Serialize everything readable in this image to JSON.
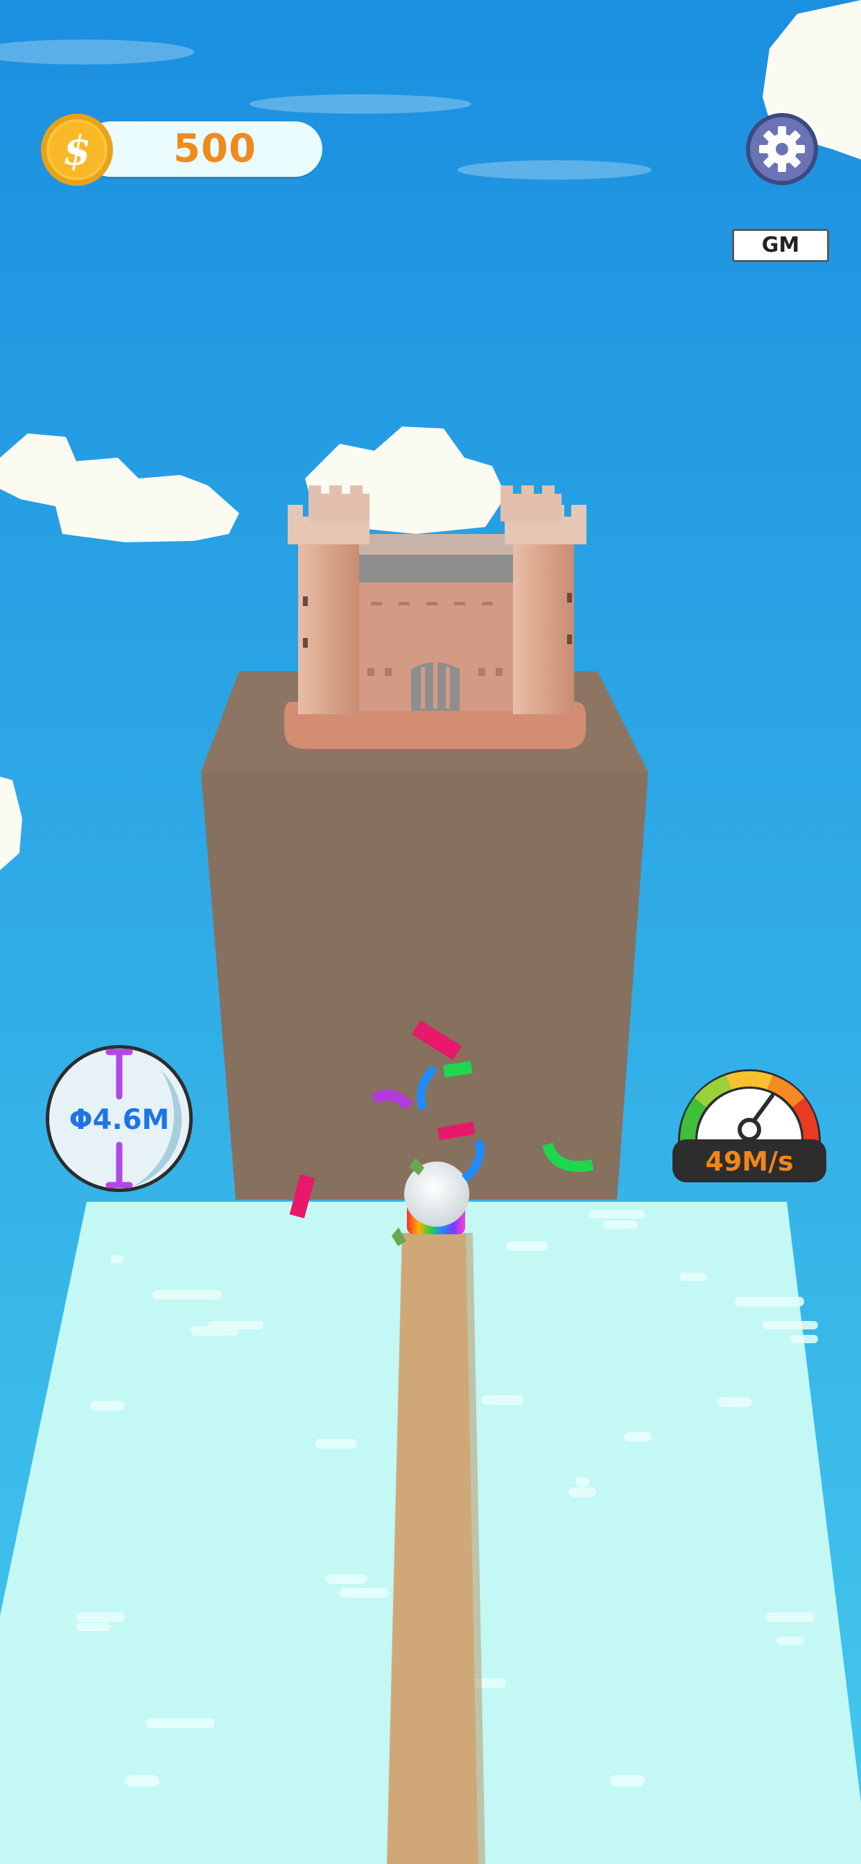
{
  "hud": {
    "coins": "500",
    "gm_label": "GM",
    "diameter": "Φ4.6M",
    "speed": "49M/s"
  },
  "icons": {
    "coin": "dollar-coin-icon",
    "settings": "gear-icon",
    "diameter": "diameter-ruler-icon",
    "speed": "speedometer-icon"
  },
  "colors": {
    "sky_top": "#1b8fe0",
    "sky_bottom": "#45c8ec",
    "tower": "#86705e",
    "castle": "#d59a80",
    "floor": "#c3f8f4",
    "track": "#d0a877",
    "coin_text": "#f08a1e",
    "diameter_text": "#1e74e6",
    "speed_text": "#f0861c"
  }
}
